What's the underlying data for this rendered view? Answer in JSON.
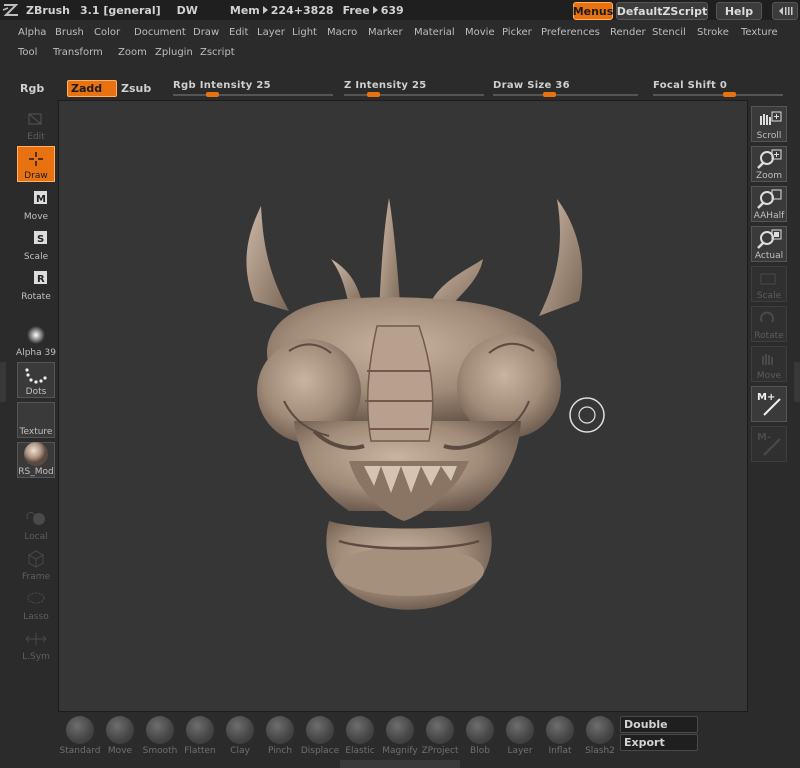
{
  "titlebar": {
    "app": "ZBrush",
    "version": "3.1 [general]",
    "mode": "DW",
    "mem_label": "Mem",
    "mem_value": "224+3828",
    "free_label": "Free",
    "free_value": "639",
    "menus": "Menus",
    "script": "DefaultZScript",
    "help": "Help"
  },
  "menus": {
    "row1": [
      "Alpha",
      "Brush",
      "Color",
      "Document",
      "Draw",
      "Edit",
      "Layer",
      "Light",
      "Macro",
      "Marker",
      "Material",
      "Movie",
      "Picker",
      "Preferences",
      "Render",
      "Stencil",
      "Stroke",
      "Texture"
    ],
    "row2": [
      "Tool",
      "Transform",
      "Zoom",
      "Zplugin",
      "Zscript"
    ]
  },
  "toolbar": {
    "rgb": "Rgb",
    "zadd": "Zadd",
    "zsub": "Zsub",
    "sliders": [
      {
        "label": "Rgb  Intensity 25",
        "value": 25
      },
      {
        "label": "Z  Intensity 25",
        "value": 25
      },
      {
        "label": "Draw  Size 36",
        "value": 36
      },
      {
        "label": "Focal  Shift 0",
        "value": 0
      }
    ]
  },
  "left_shelf": {
    "edit": "Edit",
    "draw": "Draw",
    "move": "Move",
    "scale": "Scale",
    "rotate": "Rotate",
    "alpha": "Alpha 39",
    "dots": "Dots",
    "texture": "Texture",
    "material": "RS_Mod",
    "local": "Local",
    "frame": "Frame",
    "lasso": "Lasso",
    "lsym": "L.Sym"
  },
  "right_shelf": {
    "scroll": "Scroll",
    "zoom": "Zoom",
    "aahalf": "AAHalf",
    "actual": "Actual",
    "scale": "Scale",
    "rotate": "Rotate",
    "move": "Move"
  },
  "brushes": [
    "Standard",
    "Move",
    "Smooth",
    "Flatten",
    "Clay",
    "Pinch",
    "Displace",
    "Elastic",
    "Magnify",
    "ZProject",
    "Blob",
    "Layer",
    "Inflat",
    "Slash2"
  ],
  "bottom": {
    "double": "Double",
    "export": "Export"
  }
}
